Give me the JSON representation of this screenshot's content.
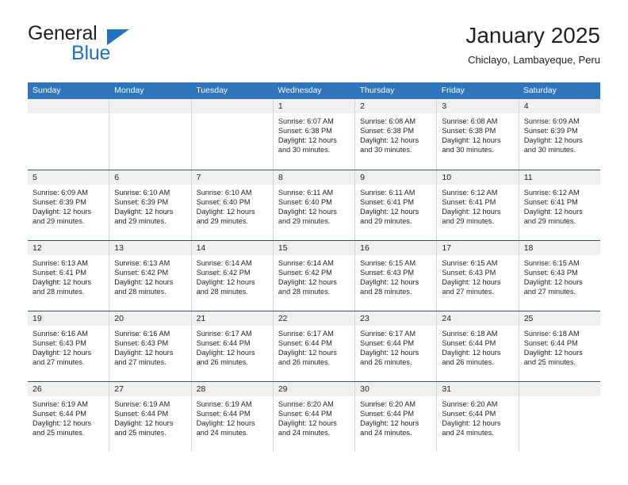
{
  "logo": {
    "word1": "General",
    "word2": "Blue",
    "triangle_color": "#1f72bd"
  },
  "header": {
    "title": "January 2025",
    "subtitle": "Chiclayo, Lambayeque, Peru"
  },
  "theme": {
    "header_row_bg": "#2f75bb",
    "header_row_text": "#ffffff",
    "day_number_bg": "#f0f0f0",
    "week_separator": "#35536f",
    "cell_border": "#d2d2d2"
  },
  "weekdays": [
    "Sunday",
    "Monday",
    "Tuesday",
    "Wednesday",
    "Thursday",
    "Friday",
    "Saturday"
  ],
  "weeks": [
    [
      {
        "day": "",
        "empty": true,
        "sunrise": "",
        "sunset": "",
        "daylight_line1": "",
        "daylight_line2": ""
      },
      {
        "day": "",
        "empty": true,
        "sunrise": "",
        "sunset": "",
        "daylight_line1": "",
        "daylight_line2": ""
      },
      {
        "day": "",
        "empty": true,
        "sunrise": "",
        "sunset": "",
        "daylight_line1": "",
        "daylight_line2": ""
      },
      {
        "day": "1",
        "empty": false,
        "sunrise": "Sunrise: 6:07 AM",
        "sunset": "Sunset: 6:38 PM",
        "daylight_line1": "Daylight: 12 hours",
        "daylight_line2": "and 30 minutes."
      },
      {
        "day": "2",
        "empty": false,
        "sunrise": "Sunrise: 6:08 AM",
        "sunset": "Sunset: 6:38 PM",
        "daylight_line1": "Daylight: 12 hours",
        "daylight_line2": "and 30 minutes."
      },
      {
        "day": "3",
        "empty": false,
        "sunrise": "Sunrise: 6:08 AM",
        "sunset": "Sunset: 6:38 PM",
        "daylight_line1": "Daylight: 12 hours",
        "daylight_line2": "and 30 minutes."
      },
      {
        "day": "4",
        "empty": false,
        "sunrise": "Sunrise: 6:09 AM",
        "sunset": "Sunset: 6:39 PM",
        "daylight_line1": "Daylight: 12 hours",
        "daylight_line2": "and 30 minutes."
      }
    ],
    [
      {
        "day": "5",
        "empty": false,
        "sunrise": "Sunrise: 6:09 AM",
        "sunset": "Sunset: 6:39 PM",
        "daylight_line1": "Daylight: 12 hours",
        "daylight_line2": "and 29 minutes."
      },
      {
        "day": "6",
        "empty": false,
        "sunrise": "Sunrise: 6:10 AM",
        "sunset": "Sunset: 6:39 PM",
        "daylight_line1": "Daylight: 12 hours",
        "daylight_line2": "and 29 minutes."
      },
      {
        "day": "7",
        "empty": false,
        "sunrise": "Sunrise: 6:10 AM",
        "sunset": "Sunset: 6:40 PM",
        "daylight_line1": "Daylight: 12 hours",
        "daylight_line2": "and 29 minutes."
      },
      {
        "day": "8",
        "empty": false,
        "sunrise": "Sunrise: 6:11 AM",
        "sunset": "Sunset: 6:40 PM",
        "daylight_line1": "Daylight: 12 hours",
        "daylight_line2": "and 29 minutes."
      },
      {
        "day": "9",
        "empty": false,
        "sunrise": "Sunrise: 6:11 AM",
        "sunset": "Sunset: 6:41 PM",
        "daylight_line1": "Daylight: 12 hours",
        "daylight_line2": "and 29 minutes."
      },
      {
        "day": "10",
        "empty": false,
        "sunrise": "Sunrise: 6:12 AM",
        "sunset": "Sunset: 6:41 PM",
        "daylight_line1": "Daylight: 12 hours",
        "daylight_line2": "and 29 minutes."
      },
      {
        "day": "11",
        "empty": false,
        "sunrise": "Sunrise: 6:12 AM",
        "sunset": "Sunset: 6:41 PM",
        "daylight_line1": "Daylight: 12 hours",
        "daylight_line2": "and 29 minutes."
      }
    ],
    [
      {
        "day": "12",
        "empty": false,
        "sunrise": "Sunrise: 6:13 AM",
        "sunset": "Sunset: 6:41 PM",
        "daylight_line1": "Daylight: 12 hours",
        "daylight_line2": "and 28 minutes."
      },
      {
        "day": "13",
        "empty": false,
        "sunrise": "Sunrise: 6:13 AM",
        "sunset": "Sunset: 6:42 PM",
        "daylight_line1": "Daylight: 12 hours",
        "daylight_line2": "and 28 minutes."
      },
      {
        "day": "14",
        "empty": false,
        "sunrise": "Sunrise: 6:14 AM",
        "sunset": "Sunset: 6:42 PM",
        "daylight_line1": "Daylight: 12 hours",
        "daylight_line2": "and 28 minutes."
      },
      {
        "day": "15",
        "empty": false,
        "sunrise": "Sunrise: 6:14 AM",
        "sunset": "Sunset: 6:42 PM",
        "daylight_line1": "Daylight: 12 hours",
        "daylight_line2": "and 28 minutes."
      },
      {
        "day": "16",
        "empty": false,
        "sunrise": "Sunrise: 6:15 AM",
        "sunset": "Sunset: 6:43 PM",
        "daylight_line1": "Daylight: 12 hours",
        "daylight_line2": "and 28 minutes."
      },
      {
        "day": "17",
        "empty": false,
        "sunrise": "Sunrise: 6:15 AM",
        "sunset": "Sunset: 6:43 PM",
        "daylight_line1": "Daylight: 12 hours",
        "daylight_line2": "and 27 minutes."
      },
      {
        "day": "18",
        "empty": false,
        "sunrise": "Sunrise: 6:15 AM",
        "sunset": "Sunset: 6:43 PM",
        "daylight_line1": "Daylight: 12 hours",
        "daylight_line2": "and 27 minutes."
      }
    ],
    [
      {
        "day": "19",
        "empty": false,
        "sunrise": "Sunrise: 6:16 AM",
        "sunset": "Sunset: 6:43 PM",
        "daylight_line1": "Daylight: 12 hours",
        "daylight_line2": "and 27 minutes."
      },
      {
        "day": "20",
        "empty": false,
        "sunrise": "Sunrise: 6:16 AM",
        "sunset": "Sunset: 6:43 PM",
        "daylight_line1": "Daylight: 12 hours",
        "daylight_line2": "and 27 minutes."
      },
      {
        "day": "21",
        "empty": false,
        "sunrise": "Sunrise: 6:17 AM",
        "sunset": "Sunset: 6:44 PM",
        "daylight_line1": "Daylight: 12 hours",
        "daylight_line2": "and 26 minutes."
      },
      {
        "day": "22",
        "empty": false,
        "sunrise": "Sunrise: 6:17 AM",
        "sunset": "Sunset: 6:44 PM",
        "daylight_line1": "Daylight: 12 hours",
        "daylight_line2": "and 26 minutes."
      },
      {
        "day": "23",
        "empty": false,
        "sunrise": "Sunrise: 6:17 AM",
        "sunset": "Sunset: 6:44 PM",
        "daylight_line1": "Daylight: 12 hours",
        "daylight_line2": "and 26 minutes."
      },
      {
        "day": "24",
        "empty": false,
        "sunrise": "Sunrise: 6:18 AM",
        "sunset": "Sunset: 6:44 PM",
        "daylight_line1": "Daylight: 12 hours",
        "daylight_line2": "and 26 minutes."
      },
      {
        "day": "25",
        "empty": false,
        "sunrise": "Sunrise: 6:18 AM",
        "sunset": "Sunset: 6:44 PM",
        "daylight_line1": "Daylight: 12 hours",
        "daylight_line2": "and 25 minutes."
      }
    ],
    [
      {
        "day": "26",
        "empty": false,
        "sunrise": "Sunrise: 6:19 AM",
        "sunset": "Sunset: 6:44 PM",
        "daylight_line1": "Daylight: 12 hours",
        "daylight_line2": "and 25 minutes."
      },
      {
        "day": "27",
        "empty": false,
        "sunrise": "Sunrise: 6:19 AM",
        "sunset": "Sunset: 6:44 PM",
        "daylight_line1": "Daylight: 12 hours",
        "daylight_line2": "and 25 minutes."
      },
      {
        "day": "28",
        "empty": false,
        "sunrise": "Sunrise: 6:19 AM",
        "sunset": "Sunset: 6:44 PM",
        "daylight_line1": "Daylight: 12 hours",
        "daylight_line2": "and 24 minutes."
      },
      {
        "day": "29",
        "empty": false,
        "sunrise": "Sunrise: 6:20 AM",
        "sunset": "Sunset: 6:44 PM",
        "daylight_line1": "Daylight: 12 hours",
        "daylight_line2": "and 24 minutes."
      },
      {
        "day": "30",
        "empty": false,
        "sunrise": "Sunrise: 6:20 AM",
        "sunset": "Sunset: 6:44 PM",
        "daylight_line1": "Daylight: 12 hours",
        "daylight_line2": "and 24 minutes."
      },
      {
        "day": "31",
        "empty": false,
        "sunrise": "Sunrise: 6:20 AM",
        "sunset": "Sunset: 6:44 PM",
        "daylight_line1": "Daylight: 12 hours",
        "daylight_line2": "and 24 minutes."
      },
      {
        "day": "",
        "empty": true,
        "sunrise": "",
        "sunset": "",
        "daylight_line1": "",
        "daylight_line2": ""
      }
    ]
  ]
}
